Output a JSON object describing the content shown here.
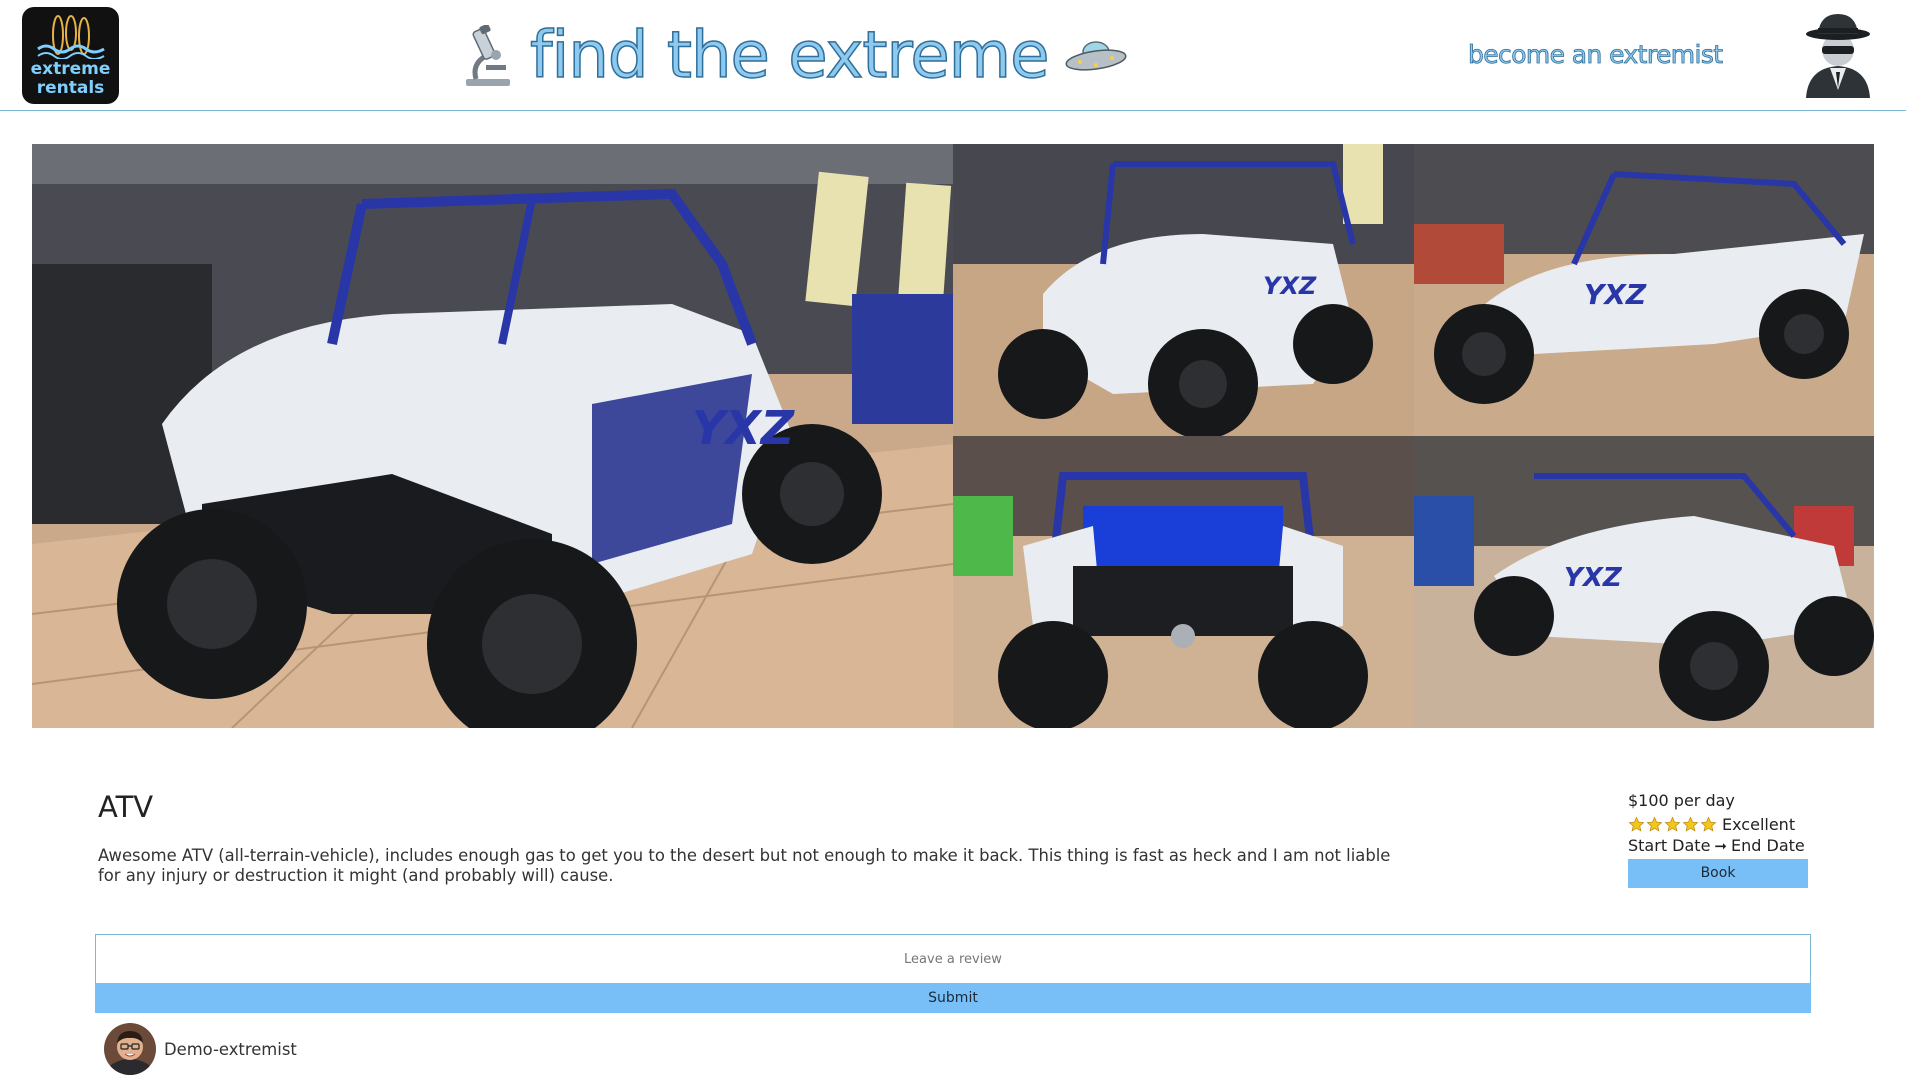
{
  "header": {
    "logo": {
      "line1": "extreme",
      "line2": "rentals",
      "icon": "surfboards-logo"
    },
    "brand_left_icon": "microscope-icon",
    "brand_title": "find the extreme",
    "brand_right_icon": "ufo-icon",
    "become_link": "become an extremist",
    "profile_icon": "spy-avatar-icon"
  },
  "gallery": {
    "photos": [
      {
        "alt": "White and blue UTV in showroom, front three-quarter view"
      },
      {
        "alt": "White and blue UTV front view"
      },
      {
        "alt": "White and blue UTV side view"
      },
      {
        "alt": "UTV rear cargo bed view"
      },
      {
        "alt": "UTV rear three-quarter view"
      }
    ]
  },
  "listing": {
    "title": "ATV",
    "description": "Awesome ATV (all-terrain-vehicle), includes enough gas to get you to the desert but not enough to make it back. This thing is fast as heck and I am not liable for any injury or destruction it might (and probably will) cause.",
    "price": "$100 per day",
    "rating_stars": 5,
    "rating_word": "Excellent",
    "start_date": "Start Date",
    "end_date": "End Date",
    "book_label": "Book"
  },
  "review": {
    "placeholder": "Leave a review",
    "submit_label": "Submit"
  },
  "reviewer": {
    "name": "Demo-extremist"
  },
  "colors": {
    "accent": "#78bff7",
    "brand_fill": "#8ec9ef",
    "brand_stroke": "#2f6f9a",
    "divider": "#7fb8d6",
    "star": "#f5c518"
  }
}
